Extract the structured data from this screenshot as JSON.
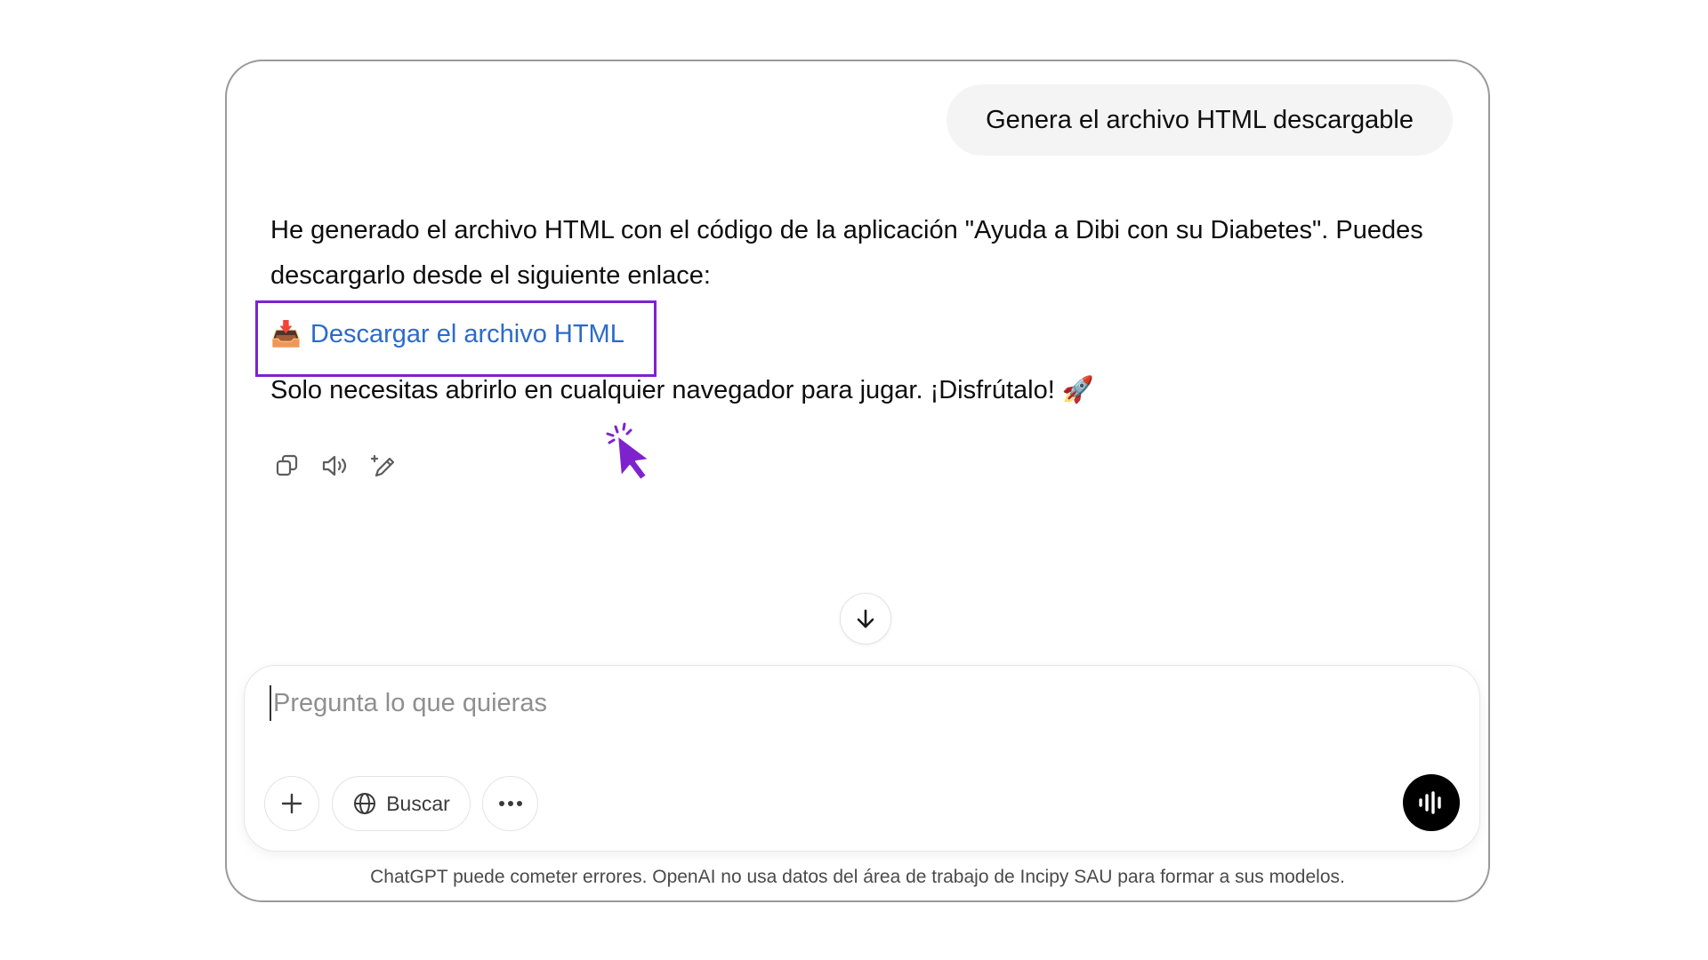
{
  "conversation": {
    "user_message": "Genera el archivo HTML descargable",
    "assistant": {
      "intro": "He generado el archivo HTML con el código de la aplicación \"Ayuda a Dibi con su Diabetes\". Puedes descargarlo desde el siguiente enlace:",
      "link_emoji": "📥",
      "link_label": "Descargar el archivo HTML",
      "outro": "Solo necesitas abrirlo en cualquier navegador para jugar. ¡Disfrútalo! 🚀"
    },
    "actions": [
      "copy-icon",
      "read-aloud-icon",
      "edit-icon"
    ]
  },
  "composer": {
    "placeholder": "Pregunta lo que quieras",
    "search_label": "Buscar"
  },
  "footer": {
    "disclaimer": "ChatGPT puede cometer errores. OpenAI no usa datos del área de trabajo de Incipy SAU para formar a sus modelos."
  },
  "colors": {
    "link": "#2c6bc9",
    "highlight": "#7e22ce",
    "cursor": "#7e22ce",
    "user_bubble": "#f4f4f4"
  }
}
